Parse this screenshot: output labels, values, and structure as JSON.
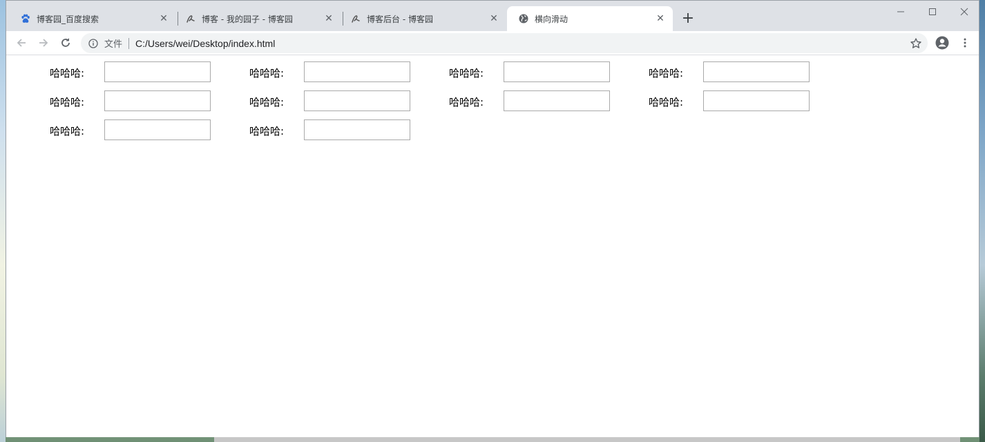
{
  "browser": {
    "tabs": [
      {
        "title": "博客园_百度搜索",
        "icon": "baidu-paw-icon"
      },
      {
        "title": "博客 - 我的园子 - 博客园",
        "icon": "cnblogs-icon"
      },
      {
        "title": "博客后台 - 博客园",
        "icon": "cnblogs-icon"
      },
      {
        "title": "横向滑动",
        "icon": "globe-icon",
        "active": true
      }
    ],
    "close_glyph": "✕",
    "new_tab_glyph": "+",
    "address_bar": {
      "scheme_label": "文件",
      "url": "C:/Users/wei/Desktop/index.html"
    }
  },
  "form": {
    "rows": [
      [
        {
          "label": "哈哈哈:",
          "value": ""
        },
        {
          "label": "哈哈哈:",
          "value": ""
        },
        {
          "label": "哈哈哈:",
          "value": ""
        },
        {
          "label": "哈哈哈:",
          "value": ""
        }
      ],
      [
        {
          "label": "哈哈哈:",
          "value": ""
        },
        {
          "label": "哈哈哈:",
          "value": ""
        },
        {
          "label": "哈哈哈:",
          "value": ""
        },
        {
          "label": "哈哈哈:",
          "value": ""
        }
      ],
      [
        {
          "label": "哈哈哈:",
          "value": ""
        },
        {
          "label": "哈哈哈:",
          "value": ""
        }
      ]
    ]
  },
  "colors": {
    "titlebar": "#dee1e6",
    "omnibox": "#f1f3f4",
    "baidu_blue": "#2f6fd8"
  }
}
